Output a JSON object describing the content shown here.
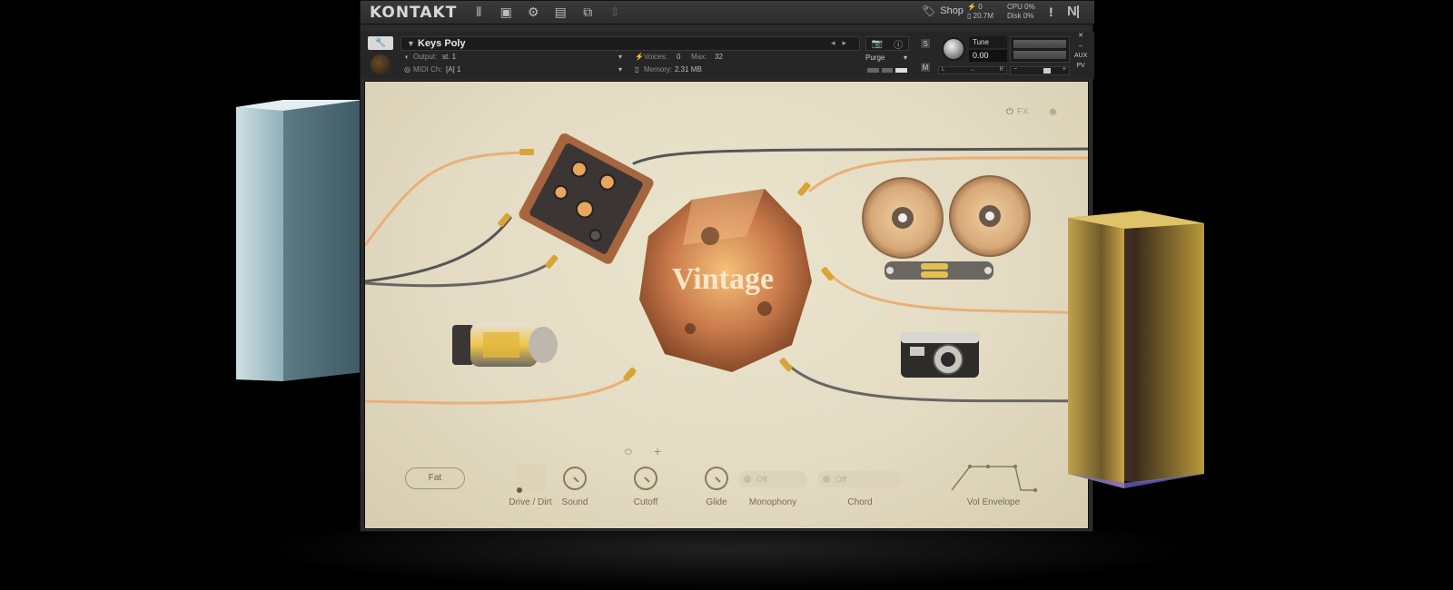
{
  "app": {
    "logo": "KONTAKT",
    "shop_label": "Shop",
    "voices_total": "0",
    "memory_total": "20.7M",
    "cpu": "CPU 0%",
    "disk": "Disk 0%",
    "warning": "!",
    "ni_logo": "N|"
  },
  "toolbar": {
    "icons": [
      "library-icon",
      "save-icon",
      "gear-icon",
      "layout-icon",
      "resize-icon",
      "up-down-icon"
    ]
  },
  "instrument": {
    "name": "Keys Poly",
    "output_label": "Output:",
    "output_value": "st. 1",
    "midi_label": "MIDI Ch:",
    "midi_value": "[A]  1",
    "voices_label": "Voices:",
    "voices_value": "0",
    "max_label": "Max:",
    "max_value": "32",
    "memory_label": "Memory:",
    "memory_value": "2.31 MB",
    "purge_label": "Purge",
    "solo": "S",
    "mute": "M",
    "tune_label": "Tune",
    "tune_value": "0.00",
    "pan_left": "L",
    "pan_center": "↔",
    "pan_right": "R",
    "aux": "AUX",
    "pv": "PV"
  },
  "panel": {
    "title": "Vintage",
    "fx_label": "FX",
    "fat_button": "Fat",
    "labels": {
      "drive": "Drive / Dirt",
      "sound": "Sound",
      "cutoff": "Cutoff",
      "glide": "Glide",
      "monophony": "Monophony",
      "chord": "Chord",
      "vol_envelope": "Vol Envelope"
    },
    "monophony_value": "Off",
    "chord_value": "Off"
  },
  "colors": {
    "panel_bg": "#e8e0c9",
    "accent_orange": "#e8a55c",
    "label_brown": "#7a6a52",
    "chrome_dark": "#2b2b2b"
  }
}
